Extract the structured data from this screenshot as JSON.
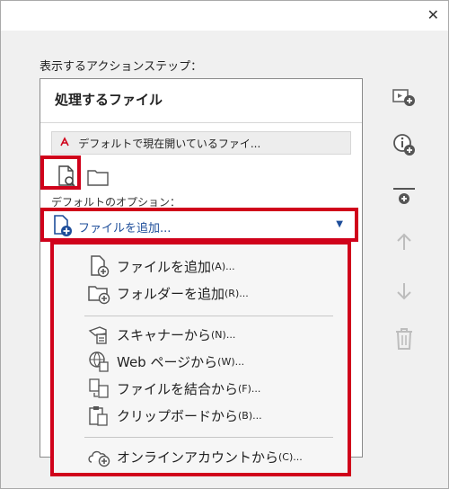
{
  "window": {
    "close_glyph": "✕"
  },
  "section_label": "表示するアクションステップ：",
  "panel": {
    "title": "処理するファイル",
    "file_row": "デフォルトで現在開いているファイ...",
    "default_options_label": "デフォルトのオプション：",
    "combo_value": "ファイルを追加..."
  },
  "dropdown": {
    "items": [
      {
        "label": "ファイルを追加",
        "access": "(A)...",
        "icon": "file-add-icon"
      },
      {
        "label": "フォルダーを追加",
        "access": "(R)...",
        "icon": "folder-add-icon"
      },
      {
        "label": "スキャナーから",
        "access": "(N)...",
        "icon": "scanner-icon"
      },
      {
        "label": "Web ページから",
        "access": "(W)...",
        "icon": "web-page-icon"
      },
      {
        "label": "ファイルを結合から",
        "access": "(F)...",
        "icon": "combine-files-icon"
      },
      {
        "label": "クリップボードから",
        "access": "(B)...",
        "icon": "clipboard-icon"
      },
      {
        "label": "オンラインアカウントから",
        "access": "(C)...",
        "icon": "cloud-account-icon"
      }
    ]
  },
  "sidebar_icons": [
    "add-step-icon",
    "add-instruction-icon",
    "add-separator-icon",
    "move-up-icon",
    "move-down-icon",
    "delete-icon"
  ],
  "colors": {
    "highlight": "#d0021b",
    "accent_blue": "#1e4e9a",
    "pdf_red": "#d0021b"
  }
}
